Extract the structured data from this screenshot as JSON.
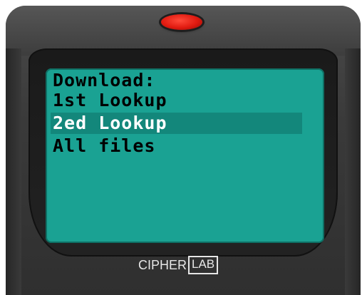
{
  "screen": {
    "lines": [
      "Download:",
      "1st Lookup",
      "2ed Lookup",
      "All files"
    ],
    "selected_index": 2
  },
  "brand": {
    "part1": "CIPHER",
    "part2": "LAB"
  },
  "colors": {
    "screen_bg": "#1aa293",
    "highlight_bg": "#13877b",
    "led": "#e01a10",
    "device_body": "#3a3a3a"
  }
}
